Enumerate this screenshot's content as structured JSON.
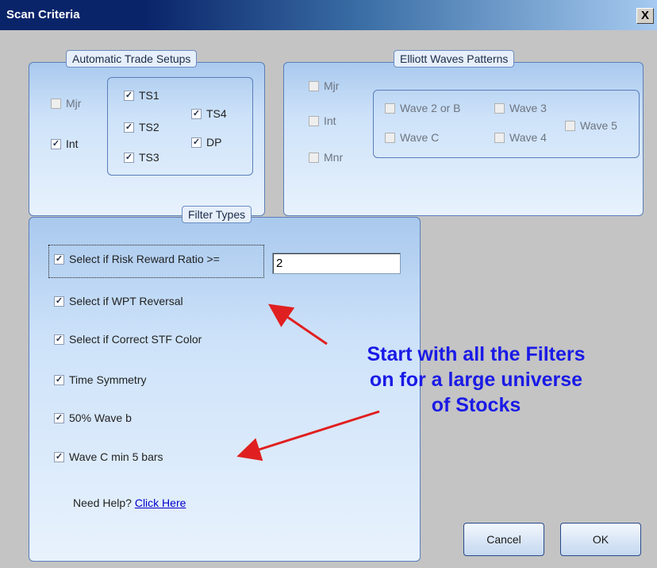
{
  "window": {
    "title": "Scan Criteria",
    "close_glyph": "X"
  },
  "auto_setups": {
    "label": "Automatic Trade Setups",
    "mjr": {
      "label": "Mjr",
      "checked": false,
      "enabled": false
    },
    "int": {
      "label": "Int",
      "checked": true,
      "enabled": true
    },
    "ts1": {
      "label": "TS1",
      "checked": true
    },
    "ts2": {
      "label": "TS2",
      "checked": true
    },
    "ts3": {
      "label": "TS3",
      "checked": true
    },
    "ts4": {
      "label": "TS4",
      "checked": true
    },
    "dp": {
      "label": "DP",
      "checked": true
    }
  },
  "elliott": {
    "label": "Elliott Waves Patterns",
    "mjr": {
      "label": "Mjr",
      "checked": false
    },
    "int": {
      "label": "Int",
      "checked": false
    },
    "mnr": {
      "label": "Mnr",
      "checked": false
    },
    "wave2b": {
      "label": "Wave 2 or B",
      "checked": false
    },
    "wave3": {
      "label": "Wave 3",
      "checked": false
    },
    "wave_c": {
      "label": "Wave C",
      "checked": false
    },
    "wave4": {
      "label": "Wave 4",
      "checked": false
    },
    "wave5": {
      "label": "Wave 5",
      "checked": false
    }
  },
  "filters": {
    "label": "Filter Types",
    "risk_reward": {
      "label": "Select if Risk Reward Ratio >=",
      "checked": true,
      "value": "2"
    },
    "wpt_reversal": {
      "label": "Select if WPT Reversal",
      "checked": true
    },
    "stf_color": {
      "label": "Select if Correct STF Color",
      "checked": true
    },
    "time_symmetry": {
      "label": "Time Symmetry",
      "checked": true
    },
    "wave_b": {
      "label": "50% Wave b",
      "checked": true
    },
    "wave_c_bars": {
      "label": "Wave C min 5 bars",
      "checked": true
    },
    "help_text": "Need Help?",
    "help_link": "Click Here"
  },
  "buttons": {
    "cancel": "Cancel",
    "ok": "OK"
  },
  "annotation": {
    "line1": "Start with all the Filters",
    "line2": "on for a large universe",
    "line3": "of Stocks",
    "text_color": "#1a1ae6",
    "arrow_color": "#e02020"
  }
}
